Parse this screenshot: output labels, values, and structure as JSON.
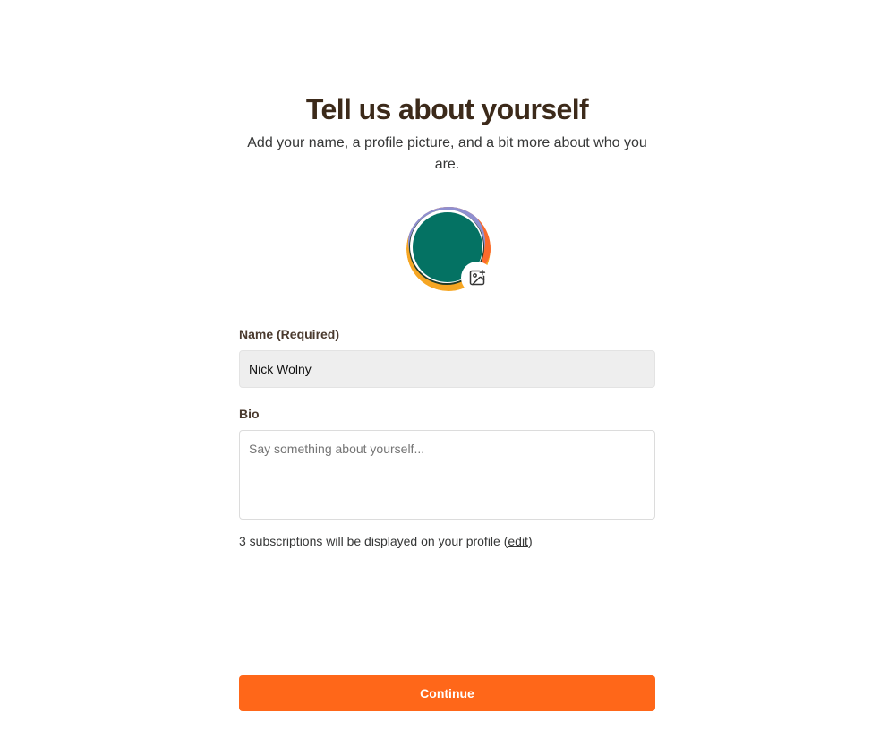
{
  "header": {
    "title": "Tell us about yourself",
    "subtitle": "Add your name, a profile picture, and a bit more about who you are."
  },
  "avatar": {
    "upload_icon": "image-add-icon",
    "colors": {
      "primary": "#047263",
      "accent_orange": "#fb6a2c",
      "accent_yellow": "#f6a623",
      "accent_purple": "#8f8fd0"
    }
  },
  "form": {
    "name_label": "Name (Required)",
    "name_value": "Nick Wolny",
    "bio_label": "Bio",
    "bio_placeholder": "Say something about yourself...",
    "subscriptions_text": "3 subscriptions will be displayed on your profile (",
    "subscriptions_edit": "edit",
    "subscriptions_close": ")"
  },
  "actions": {
    "continue_label": "Continue",
    "brand_color": "#ff6719"
  }
}
